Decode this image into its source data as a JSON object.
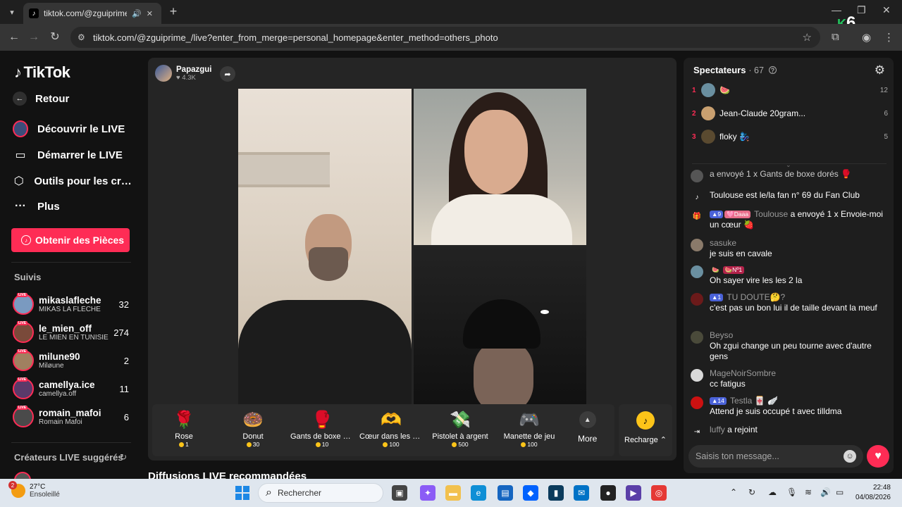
{
  "browser": {
    "tab_title": "tiktok.com/@zguiprime_/live",
    "url": "tiktok.com/@zguiprime_/live?enter_from_merge=personal_homepage&enter_method=others_photo",
    "overlay_badge": "6",
    "overlay_badge_letter": "K"
  },
  "sidebar": {
    "logo": "TikTok",
    "back_label": "Retour",
    "menu": [
      {
        "label": "Découvrir le LIVE"
      },
      {
        "label": "Démarrer le LIVE"
      },
      {
        "label": "Outils pour les créateurs"
      },
      {
        "label": "Plus"
      }
    ],
    "coins_button": "Obtenir des Pièces",
    "following_title": "Suivis",
    "following": [
      {
        "name": "mikaslafleche",
        "sub": "MIKAS LA FLÈCHE",
        "count": "32",
        "live": "LIVE"
      },
      {
        "name": "le_mien_off",
        "sub": "LE MIEN EN TUNISIE",
        "count": "274",
        "live": "LIVE"
      },
      {
        "name": "milune90",
        "sub": "Miløune",
        "count": "2",
        "live": "LIVE"
      },
      {
        "name": "camellya.ice",
        "sub": "camellya.off",
        "count": "11",
        "live": "LIVE"
      },
      {
        "name": "romain_mafoi",
        "sub": "Romain Mafoi",
        "count": "6",
        "live": "LIVE"
      }
    ],
    "suggested_title": "Créateurs LIVE suggérés"
  },
  "stream": {
    "host_name": "Papazgui",
    "host_likes": "4.3K",
    "recommended_title": "Diffusions LIVE recommandées"
  },
  "gifts": [
    {
      "name": "Rose",
      "price": "1",
      "icon": "🌹"
    },
    {
      "name": "Donut",
      "price": "30",
      "icon": "🍩"
    },
    {
      "name": "Gants de boxe dorés",
      "price": "10",
      "icon": "🥊"
    },
    {
      "name": "Cœur dans les mains",
      "price": "100",
      "icon": "🫶"
    },
    {
      "name": "Pistolet à argent",
      "price": "500",
      "icon": "💸"
    },
    {
      "name": "Manette de jeu",
      "price": "100",
      "icon": "🎮"
    }
  ],
  "gift_more": "More",
  "recharge": "Recharge",
  "chat": {
    "title": "Spectateurs",
    "viewer_count": "· 67",
    "ranking": [
      {
        "rank": "1",
        "name": "🍉",
        "score": "12",
        "color": "#6a8fa0"
      },
      {
        "rank": "2",
        "name": "Jean-Claude 20gram...",
        "score": "6",
        "color": "#c9a070"
      },
      {
        "rank": "3",
        "name": "floky 🧞‍♀️",
        "score": "5",
        "color": "#5a4a30"
      }
    ],
    "messages": [
      {
        "user": "",
        "badges": [],
        "text": "a envoyé 1 x Gants de boxe dorés 🥊",
        "avatar": "#555"
      },
      {
        "user": "",
        "badges": [],
        "text": "Toulouse est le/la fan n° 69 du Fan Club",
        "avatar": "#333"
      },
      {
        "user": "Toulouse",
        "badges": [
          "▲9",
          "🩷Daaa"
        ],
        "text": "a envoyé 1 x Envoie-moi un cœur 🍓",
        "avatar": "#333"
      },
      {
        "user": "sasuke",
        "badges": [],
        "text": "je suis en cavale",
        "avatar": "#8a7a6a"
      },
      {
        "user": "",
        "badges": [
          "🍉",
          "🍉Nº1"
        ],
        "text": "Oh sayer vire les les 2 la",
        "avatar": "#6a8fa0"
      },
      {
        "user": "TU DOUTE🤔?",
        "badges": [
          "▲1"
        ],
        "text": "c'est pas un bon lui il de taille devant la meuf",
        "avatar": "#6b1a1a"
      },
      {
        "user": "Beyso",
        "badges": [],
        "text": "Oh zgui change un peu tourne avec d'autre gens",
        "avatar": "#4a4a3a"
      },
      {
        "user": "MageNoirSombre",
        "badges": [],
        "text": "cc fatigus",
        "avatar": "#d9d9d9"
      },
      {
        "user": "Testla 🀄 🪽",
        "badges": [
          "▲14"
        ],
        "text": "Attend je suis occupé t avec tilldma",
        "avatar": "#cc1111"
      },
      {
        "user": "luffy",
        "badges": [],
        "text": "a rejoint",
        "avatar": "#333"
      }
    ],
    "input_placeholder": "Saisis ton message..."
  },
  "taskbar": {
    "temperature": "27°C",
    "weather": "Ensoleillé",
    "weather_badge": "2",
    "search_placeholder": "Rechercher",
    "time": "22:48",
    "date": "04/08/2026"
  }
}
